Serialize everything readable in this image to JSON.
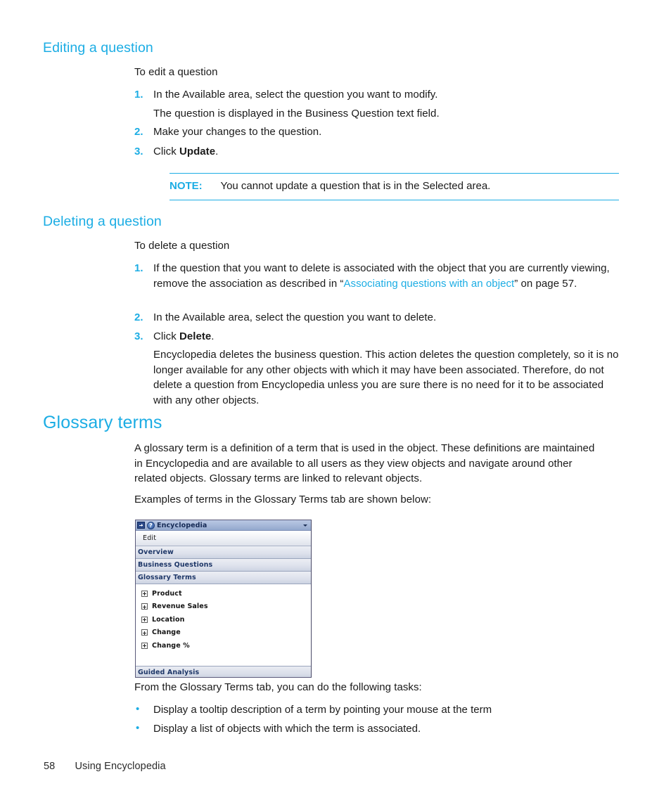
{
  "theme": {
    "accent_cyan": "#1CADE4",
    "body_text": "#1a1a1a",
    "widget_title_text": "#152a55",
    "widget_tab_text": "#1e3768"
  },
  "sections": {
    "editing": {
      "heading": "Editing a question",
      "intro": "To edit a question",
      "steps": [
        {
          "marker": "1.",
          "text": "In the Available area, select the question you want to modify.",
          "sub": "The question is displayed in the Business Question text field."
        },
        {
          "marker": "2.",
          "text": "Make your changes to the question."
        },
        {
          "marker": "3.",
          "text_before": "Click ",
          "bold": "Update",
          "text_after": "."
        }
      ],
      "note": {
        "label": "NOTE:",
        "text": "You cannot update a question that is in the Selected area."
      }
    },
    "deleting": {
      "heading": "Deleting a question",
      "intro": "To delete a question",
      "steps": [
        {
          "marker": "1.",
          "text_before": "If the question that you want to delete is associated with the object that you are currently viewing, remove the association as described in “",
          "link": "Associating questions with an object",
          "text_after": "” on page 57."
        },
        {
          "marker": "2.",
          "text": "In the Available area, select the question you want to delete."
        },
        {
          "marker": "3.",
          "text_before": "Click ",
          "bold": "Delete",
          "text_after": ".",
          "sub": "Encyclopedia deletes the business question. This action deletes the question completely, so it is no longer available for any other objects with which it may have been associated. Therefore, do not delete a question from Encyclopedia unless you are sure there is no need for it to be associated with any other objects."
        }
      ]
    },
    "glossary": {
      "heading": "Glossary terms",
      "paragraph1": "A glossary term is a definition of a term that is used in the object. These definitions are maintained in Encyclopedia and are available to all users as they view objects and navigate around other related objects. Glossary terms are linked to relevant objects.",
      "paragraph2": "Examples of terms in the Glossary Terms tab are shown below:",
      "after_figure": "From the Glossary Terms tab, you can do the following tasks:",
      "bullets": [
        "Display a tooltip description of a term by pointing your mouse at the term",
        "Display a list of objects with which the term is associated."
      ]
    }
  },
  "figure": {
    "window": {
      "collapse_icon": "collapse-panel-icon",
      "help_icon": "help-icon",
      "help_glyph": "?",
      "title": "Encyclopedia",
      "menu_arrow_icon": "chevron-down-icon"
    },
    "toolbar": {
      "edit_label": "Edit"
    },
    "tabs": [
      {
        "label": "Overview"
      },
      {
        "label": "Business Questions"
      },
      {
        "label": "Glossary Terms"
      }
    ],
    "tree_items": [
      {
        "label": "Product",
        "expand_icon": "expand-plus-icon"
      },
      {
        "label": "Revenue Sales",
        "expand_icon": "expand-plus-icon"
      },
      {
        "label": "Location",
        "expand_icon": "expand-plus-icon"
      },
      {
        "label": "Change",
        "expand_icon": "expand-plus-icon"
      },
      {
        "label": "Change %",
        "expand_icon": "expand-plus-icon"
      }
    ],
    "footer_tab": {
      "label": "Guided Analysis"
    }
  },
  "footer": {
    "page_number": "58",
    "chapter": "Using Encyclopedia"
  }
}
